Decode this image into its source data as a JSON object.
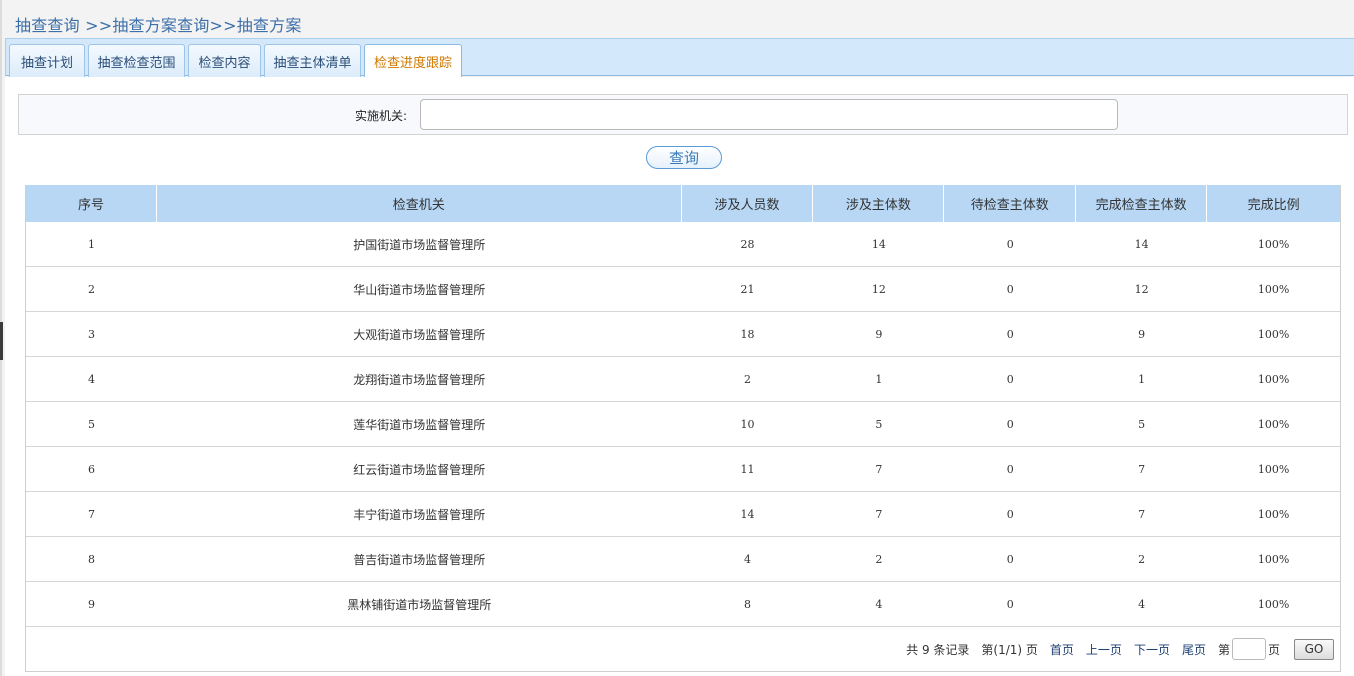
{
  "breadcrumb": {
    "level1": "抽查查询",
    "sep1": " >>",
    "level2": "抽查方案查询",
    "sep2": ">>",
    "level3": "抽查方案"
  },
  "tabs": [
    {
      "label": "抽查计划",
      "active": false
    },
    {
      "label": "抽查检查范围",
      "active": false
    },
    {
      "label": "检查内容",
      "active": false
    },
    {
      "label": "抽查主体清单",
      "active": false
    },
    {
      "label": "检查进度跟踪",
      "active": true
    }
  ],
  "filter": {
    "label": "实施机关:",
    "value": "",
    "placeholder": ""
  },
  "query_button": "查询",
  "table": {
    "headers": [
      "序号",
      "检查机关",
      "涉及人员数",
      "涉及主体数",
      "待检查主体数",
      "完成检查主体数",
      "完成比例"
    ],
    "rows": [
      [
        "1",
        "护国街道市场监督管理所",
        "28",
        "14",
        "0",
        "14",
        "100%"
      ],
      [
        "2",
        "华山街道市场监督管理所",
        "21",
        "12",
        "0",
        "12",
        "100%"
      ],
      [
        "3",
        "大观街道市场监督管理所",
        "18",
        "9",
        "0",
        "9",
        "100%"
      ],
      [
        "4",
        "龙翔街道市场监督管理所",
        "2",
        "1",
        "0",
        "1",
        "100%"
      ],
      [
        "5",
        "莲华街道市场监督管理所",
        "10",
        "5",
        "0",
        "5",
        "100%"
      ],
      [
        "6",
        "红云街道市场监督管理所",
        "11",
        "7",
        "0",
        "7",
        "100%"
      ],
      [
        "7",
        "丰宁街道市场监督管理所",
        "14",
        "7",
        "0",
        "7",
        "100%"
      ],
      [
        "8",
        "普吉街道市场监督管理所",
        "4",
        "2",
        "0",
        "2",
        "100%"
      ],
      [
        "9",
        "黑林铺街道市场监督管理所",
        "8",
        "4",
        "0",
        "4",
        "100%"
      ]
    ]
  },
  "pager": {
    "total": "共 9 条记录",
    "page_info": "第(1/1) 页",
    "first": "首页",
    "prev": "上一页",
    "next": "下一页",
    "last": "尾页",
    "goto_prefix": "第",
    "goto_value": "",
    "goto_suffix": "页",
    "go": "GO"
  }
}
